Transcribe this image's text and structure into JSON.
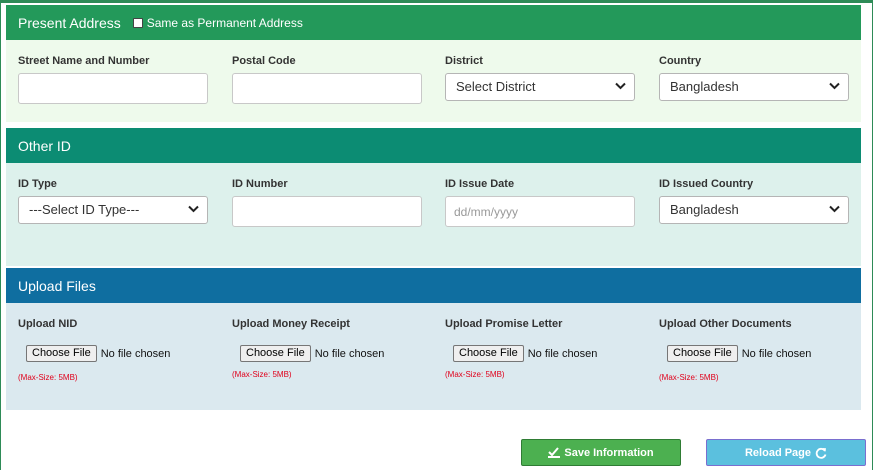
{
  "colors": {
    "present_header": "#23995a",
    "present_body": "#eefaec",
    "other_header": "#0c8c73",
    "other_body": "#ddf1ec",
    "upload_header": "#0f6ea0",
    "upload_body": "#dbe9ef",
    "save_btn": "#4cb050",
    "reload_btn": "#5bc0de",
    "error": "#e0001b"
  },
  "present_address": {
    "title": "Present Address",
    "same_as_label": "Same as Permanent Address",
    "same_as_checked": false,
    "fields": {
      "street_label": "Street Name and Number",
      "street_value": "",
      "postal_label": "Postal Code",
      "postal_value": "",
      "district_label": "District",
      "district_value": "Select District",
      "country_label": "Country",
      "country_value": "Bangladesh"
    }
  },
  "other_id": {
    "title": "Other ID",
    "fields": {
      "id_type_label": "ID Type",
      "id_type_value": "---Select ID Type---",
      "id_number_label": "ID Number",
      "id_number_value": "",
      "issue_date_label": "ID Issue Date",
      "issue_date_placeholder": "dd/mm/yyyy",
      "issued_country_label": "ID Issued Country",
      "issued_country_value": "Bangladesh"
    }
  },
  "upload_files": {
    "title": "Upload Files",
    "choose_file_label": "Choose File",
    "no_file_text": "No file chosen",
    "max_size_text": "(Max-Size: 5MB)",
    "items": [
      {
        "label": "Upload NID"
      },
      {
        "label": "Upload Money Receipt"
      },
      {
        "label": "Upload Promise Letter"
      },
      {
        "label": "Upload Other Documents"
      }
    ]
  },
  "actions": {
    "save_label": "Save Information",
    "save_icon": "check-save-icon",
    "reload_label": "Reload Page",
    "reload_icon": "refresh-icon"
  }
}
